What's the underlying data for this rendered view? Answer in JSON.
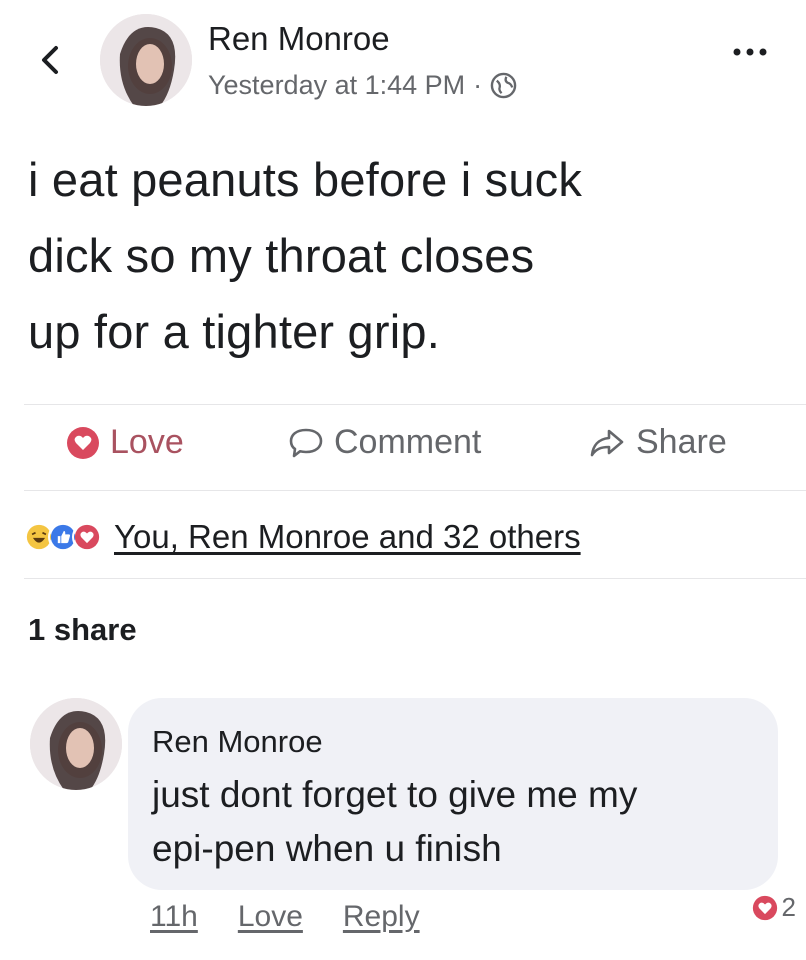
{
  "header": {
    "author": "Ren Monroe",
    "timestamp": "Yesterday at 1:44 PM",
    "separator": "·",
    "privacy_icon": "globe-icon",
    "back_icon": "chevron-left-icon",
    "more_icon": "more-dots-icon"
  },
  "post": {
    "lines": [
      "i eat peanuts before i suck",
      "dick so my throat closes",
      "up for a tighter grip."
    ]
  },
  "actions": {
    "love_label": "Love",
    "comment_label": "Comment",
    "share_label": "Share"
  },
  "reactions": {
    "icons": [
      "haha-icon",
      "like-icon",
      "love-icon"
    ],
    "summary": "You, Ren Monroe and 32 others"
  },
  "shares": "1 share",
  "comment": {
    "author": "Ren Monroe",
    "lines": [
      "just dont forget to give me my",
      "epi-pen when u finish"
    ],
    "age": "11h",
    "love_label": "Love",
    "reply_label": "Reply",
    "reaction_count": "2"
  },
  "colors": {
    "love": "#d9495e",
    "like": "#3b79e8",
    "haha": "#f4c542",
    "muted": "#65676b",
    "bubble": "#f0f1f6"
  }
}
